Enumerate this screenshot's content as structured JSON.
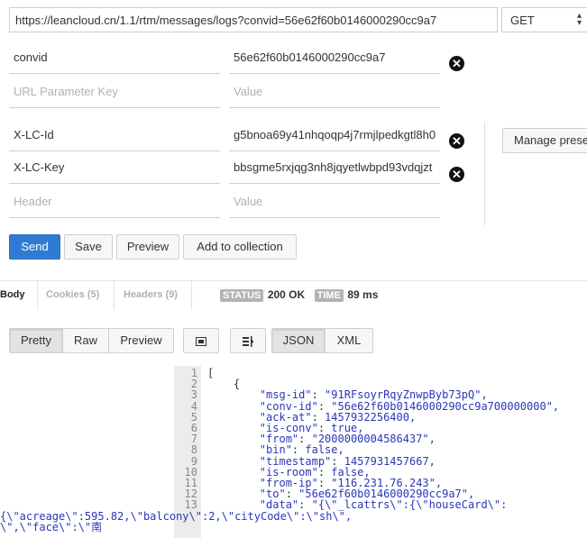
{
  "request": {
    "url": "https://leancloud.cn/1.1/rtm/messages/logs?convid=56e62f60b0146000290cc9a7",
    "method": "GET"
  },
  "params": [
    {
      "key": "convid",
      "value": "56e62f60b0146000290cc9a7"
    }
  ],
  "params_placeholder": {
    "key": "URL Parameter Key",
    "value": "Value"
  },
  "headers": [
    {
      "key": "X-LC-Id",
      "value": "g5bnoa69y41nhqoqp4j7rmjlpedkgtl8h0"
    },
    {
      "key": "X-LC-Key",
      "value": "bbsgme5rxjqg3nh8jqyetlwbpd93vdqjzt"
    }
  ],
  "headers_placeholder": {
    "key": "Header",
    "value": "Value"
  },
  "manage_presets_label": "Manage prese",
  "actions": {
    "send": "Send",
    "save": "Save",
    "preview": "Preview",
    "add_to_collection": "Add to collection"
  },
  "response_tabs": {
    "body": "Body",
    "cookies": "Cookies (5)",
    "headers": "Headers (9)"
  },
  "status": {
    "status_label": "STATUS",
    "status_value": "200 OK",
    "time_label": "TIME",
    "time_value": "89 ms"
  },
  "view_modes": {
    "pretty": "Pretty",
    "raw": "Raw",
    "preview": "Preview",
    "json": "JSON",
    "xml": "XML"
  },
  "code": {
    "line_numbers": [
      "1",
      "2",
      "3",
      "4",
      "5",
      "6",
      "7",
      "8",
      "9",
      "10",
      "11",
      "12",
      "13"
    ],
    "lines": [
      {
        "indent": "",
        "key": "",
        "sep": "[",
        "val": ""
      },
      {
        "indent": "    ",
        "key": "",
        "sep": "{",
        "val": ""
      },
      {
        "indent": "        ",
        "key": "\"msg-id\"",
        "sep": ": ",
        "val": "\"91RFsoyrRqyZnwpByb73pQ\","
      },
      {
        "indent": "        ",
        "key": "\"conv-id\"",
        "sep": ": ",
        "val": "\"56e62f60b0146000290cc9a700000000\","
      },
      {
        "indent": "        ",
        "key": "\"ack-at\"",
        "sep": ": ",
        "val": "1457932256400,"
      },
      {
        "indent": "        ",
        "key": "\"is-conv\"",
        "sep": ": ",
        "val": "true,"
      },
      {
        "indent": "        ",
        "key": "\"from\"",
        "sep": ": ",
        "val": "\"2000000004586437\","
      },
      {
        "indent": "        ",
        "key": "\"bin\"",
        "sep": ": ",
        "val": "false,"
      },
      {
        "indent": "        ",
        "key": "\"timestamp\"",
        "sep": ": ",
        "val": "1457931457667,"
      },
      {
        "indent": "        ",
        "key": "\"is-room\"",
        "sep": ": ",
        "val": "false,"
      },
      {
        "indent": "        ",
        "key": "\"from-ip\"",
        "sep": ": ",
        "val": "\"116.231.76.243\","
      },
      {
        "indent": "        ",
        "key": "\"to\"",
        "sep": ": ",
        "val": "\"56e62f60b0146000290cc9a7\","
      },
      {
        "indent": "        ",
        "key": "\"data\"",
        "sep": ": ",
        "val": "\"{\\\"_lcattrs\\\":{\\\"houseCard\\\":"
      }
    ],
    "wrap_lines": [
      "{\\\"acreage\\\":595.82,\\\"balcony\\\":2,\\\"cityCode\\\":\\\"sh\\\",",
      "\\\",\\\"face\\\":\\\"南"
    ]
  },
  "colors": {
    "accent": "#2f7bd1",
    "json_key": "#2936b8",
    "badge": "#b3b3b3"
  }
}
